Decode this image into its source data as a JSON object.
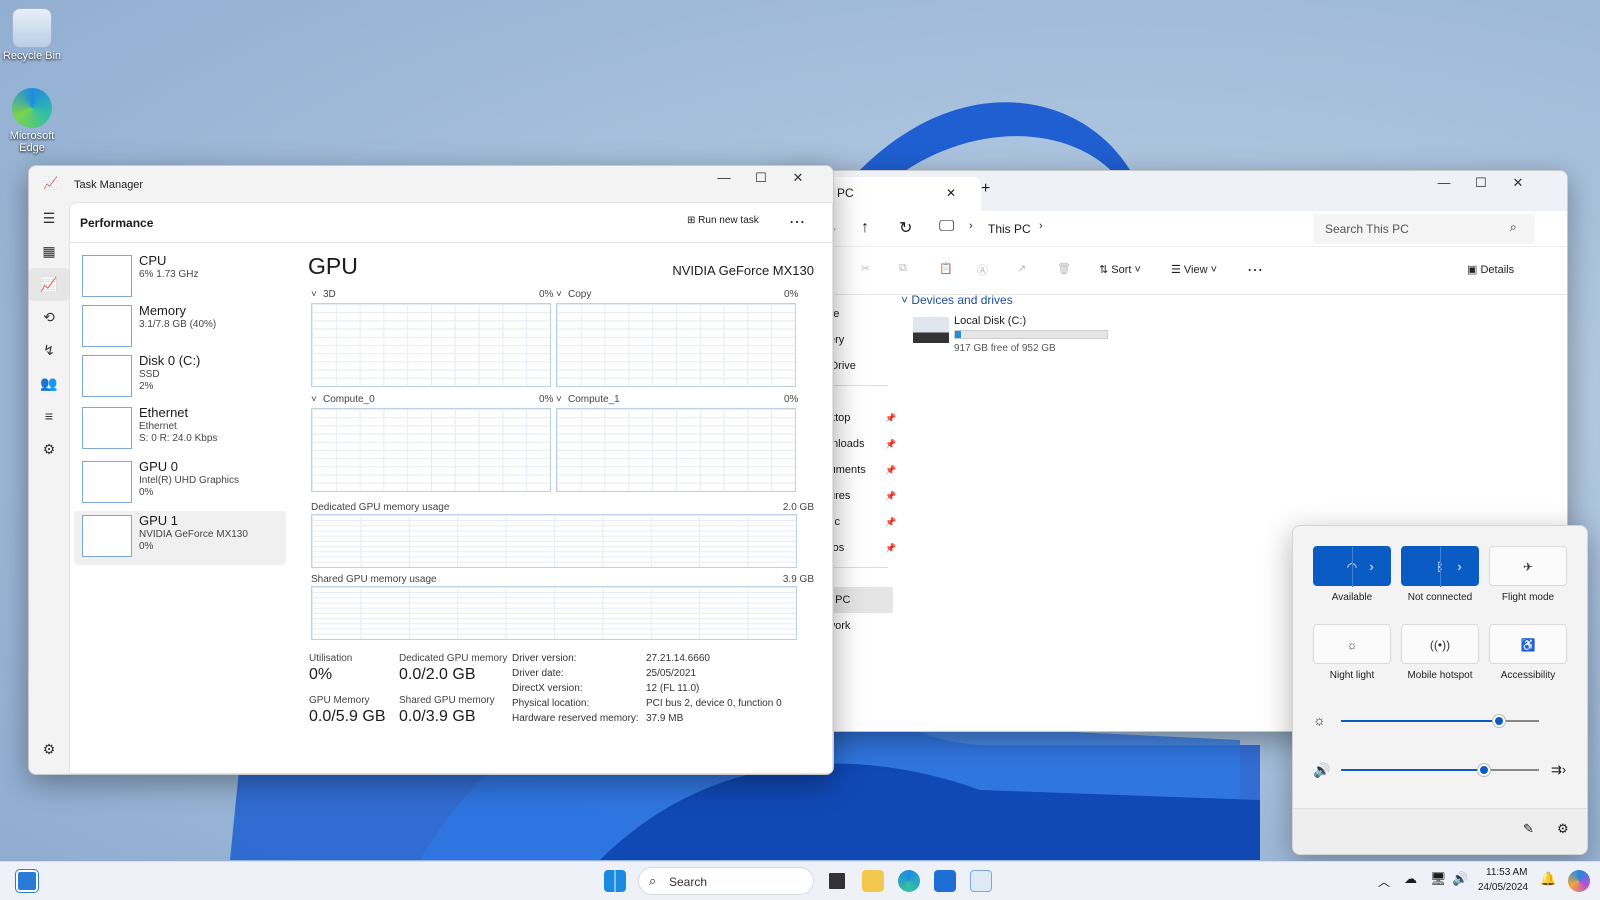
{
  "desktop": {
    "icons": [
      {
        "label": "Recycle Bin"
      },
      {
        "label": "Microsoft Edge"
      }
    ]
  },
  "explorer": {
    "tab_title": "PC",
    "new_tab": "+",
    "address_segment": "This PC",
    "search_placeholder": "Search This PC",
    "toolbar": {
      "sort": "Sort",
      "view": "View",
      "more": "⋯",
      "details": "Details"
    },
    "sidebar": [
      {
        "label": "ome",
        "pin": false
      },
      {
        "label": "allery",
        "pin": false
      },
      {
        "label": "neDrive",
        "pin": false
      },
      {
        "label": "esktop",
        "pin": true
      },
      {
        "label": "ownloads",
        "pin": true
      },
      {
        "label": "ocuments",
        "pin": true
      },
      {
        "label": "ictures",
        "pin": true
      },
      {
        "label": "lusic",
        "pin": true
      },
      {
        "label": "ideos",
        "pin": true
      },
      {
        "label": "nis PC",
        "pin": false
      },
      {
        "label": "etwork",
        "pin": false
      }
    ],
    "section": "Devices and drives",
    "drive": {
      "name": "Local Disk (C:)",
      "free_text": "917 GB free of 952 GB",
      "used_fraction": 0.037
    }
  },
  "taskmanager": {
    "title": "Task Manager",
    "section": "Performance",
    "run_new_task": "Run new task",
    "more": "⋯",
    "devices": [
      {
        "name": "CPU",
        "sub1": "6% 1.73 GHz",
        "sub2": "",
        "sub3": ""
      },
      {
        "name": "Memory",
        "sub1": "3.1/7.8 GB (40%)",
        "sub2": "",
        "sub3": ""
      },
      {
        "name": "Disk 0 (C:)",
        "sub1": "SSD",
        "sub2": "2%",
        "sub3": ""
      },
      {
        "name": "Ethernet",
        "sub1": "Ethernet",
        "sub2": "S: 0 R: 24.0 Kbps",
        "sub3": ""
      },
      {
        "name": "GPU 0",
        "sub1": "Intel(R) UHD Graphics",
        "sub2": "0%",
        "sub3": ""
      },
      {
        "name": "GPU 1",
        "sub1": "NVIDIA GeForce MX130",
        "sub2": "0%",
        "sub3": ""
      }
    ],
    "gpu": {
      "heading": "GPU",
      "model": "NVIDIA GeForce MX130",
      "engines": [
        {
          "name": "3D",
          "pct": "0%"
        },
        {
          "name": "Copy",
          "pct": "0%"
        },
        {
          "name": "Compute_0",
          "pct": "0%"
        },
        {
          "name": "Compute_1",
          "pct": "0%"
        }
      ],
      "dedicated_label": "Dedicated GPU memory usage",
      "dedicated_max": "2.0 GB",
      "shared_label": "Shared GPU memory usage",
      "shared_max": "3.9 GB",
      "stats": {
        "util_label": "Utilisation",
        "util": "0%",
        "ded_label": "Dedicated GPU memory",
        "ded": "0.0/2.0 GB",
        "gpumem_label": "GPU Memory",
        "gpumem": "0.0/5.9 GB",
        "shared_label": "Shared GPU memory",
        "shared": "0.0/3.9 GB"
      },
      "info": [
        {
          "k": "Driver version:",
          "v": "27.21.14.6660"
        },
        {
          "k": "Driver date:",
          "v": "25/05/2021"
        },
        {
          "k": "DirectX version:",
          "v": "12 (FL 11.0)"
        },
        {
          "k": "Physical location:",
          "v": "PCI bus 2, device 0, function 0"
        },
        {
          "k": "Hardware reserved memory:",
          "v": "37.9 MB"
        }
      ]
    }
  },
  "quick_settings": {
    "tiles": [
      {
        "label": "Available",
        "icon": "wifi-icon"
      },
      {
        "label": "Not connected",
        "icon": "bluetooth-icon"
      },
      {
        "label": "Flight mode",
        "icon": "airplane-icon"
      },
      {
        "label": "Night light",
        "icon": "night-light-icon"
      },
      {
        "label": "Mobile hotspot",
        "icon": "hotspot-icon"
      },
      {
        "label": "Accessibility",
        "icon": "accessibility-icon"
      }
    ],
    "brightness": 0.8,
    "volume": 0.72
  },
  "taskbar": {
    "search": "Search",
    "time": "11:53 AM",
    "date": "24/05/2024"
  },
  "colors": {
    "accent": "#0a5bc4",
    "graph_border": "#7da9d8"
  }
}
